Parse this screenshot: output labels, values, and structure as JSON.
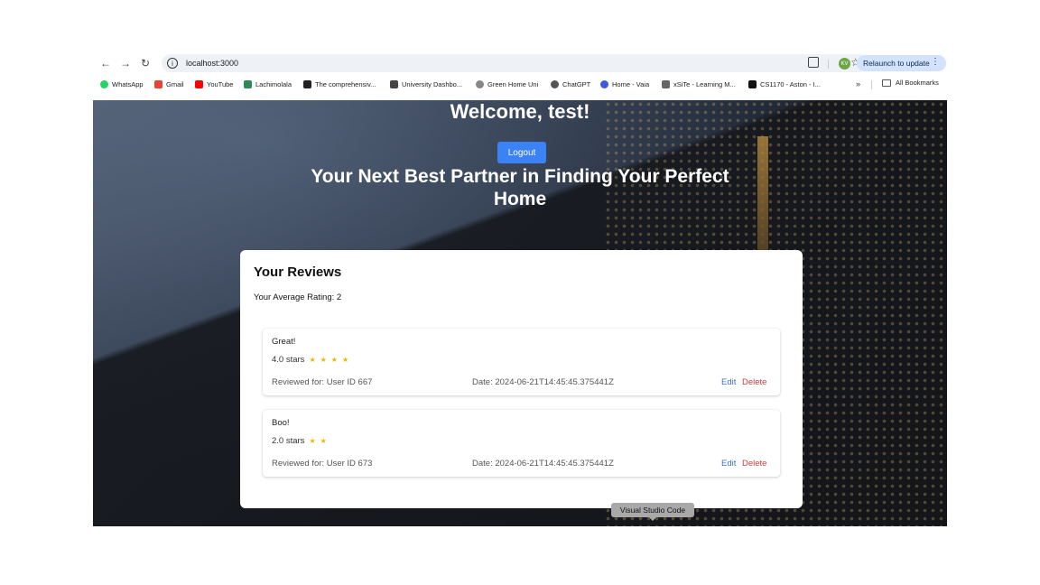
{
  "browser": {
    "url": "localhost:3000",
    "relaunch_label": "Relaunch to update",
    "profile_initials": "KV",
    "bookmarks": [
      {
        "label": "WhatsApp",
        "color": "#25d366"
      },
      {
        "label": "Gmail",
        "color": "#ea4335"
      },
      {
        "label": "YouTube",
        "color": "#ff0000"
      },
      {
        "label": "Lachimolala",
        "color": "#2e8b57"
      },
      {
        "label": "The comprehensiv...",
        "color": "#222222"
      },
      {
        "label": "University Dashbo...",
        "color": "#444444"
      },
      {
        "label": "Green Home Uni",
        "color": "#888888"
      },
      {
        "label": "ChatGPT",
        "color": "#555555"
      },
      {
        "label": "Home - Vaia",
        "color": "#3b5bdb"
      },
      {
        "label": "xSiTe - Learning M...",
        "color": "#666666"
      },
      {
        "label": "CS1170 - Aston - I...",
        "color": "#111111"
      }
    ],
    "all_bookmarks_label": "All Bookmarks"
  },
  "header": {
    "welcome": "Welcome, test!",
    "logout_label": "Logout",
    "hero": "Your Next Best Partner in Finding Your Perfect Home"
  },
  "reviews": {
    "title": "Your Reviews",
    "average": "Your Average Rating: 2",
    "items": [
      {
        "text": "Great!",
        "stars_label": "4.0 stars",
        "star_count": 4,
        "reviewed_for": "Reviewed for: User ID 667",
        "date": "Date: 2024-06-21T14:45:45.375441Z",
        "edit_label": "Edit",
        "delete_label": "Delete"
      },
      {
        "text": "Boo!",
        "stars_label": "2.0 stars",
        "star_count": 2,
        "reviewed_for": "Reviewed for: User ID 673",
        "date": "Date: 2024-06-21T14:45:45.375441Z",
        "edit_label": "Edit",
        "delete_label": "Delete"
      }
    ]
  },
  "tooltip": "Visual Studio Code",
  "colors": {
    "accent": "#3b82f6",
    "edit": "#3b6fd6",
    "delete": "#d23b3b",
    "star": "#e6b800"
  }
}
